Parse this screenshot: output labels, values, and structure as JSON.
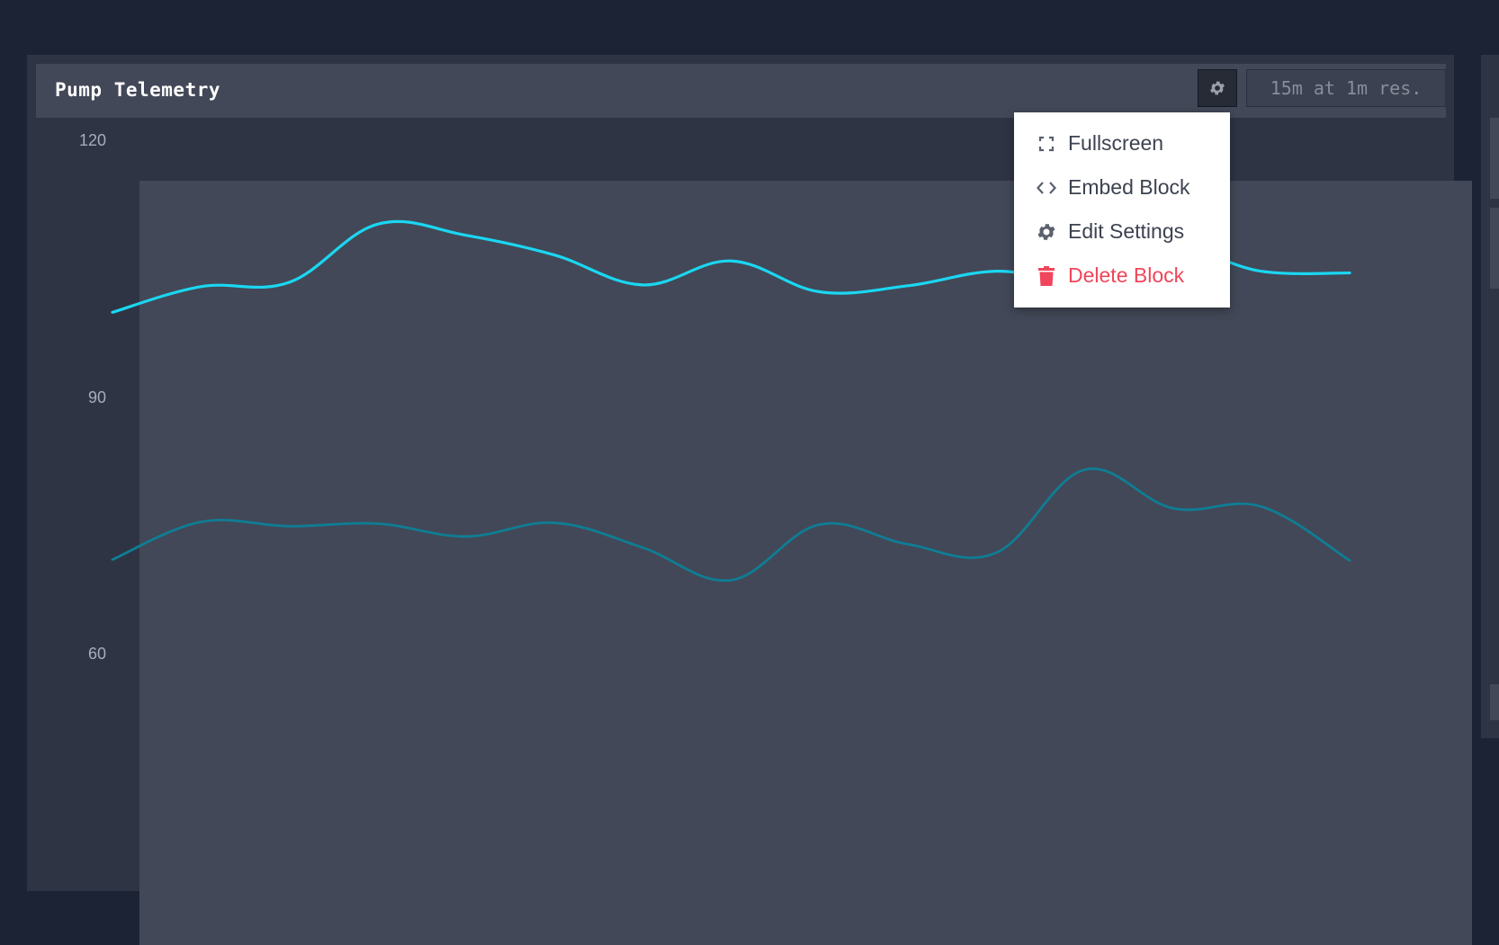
{
  "block": {
    "title": "Pump Telemetry",
    "range_label": "15m at 1m res."
  },
  "menu": {
    "items": [
      {
        "label": "Fullscreen",
        "icon": "fullscreen-icon"
      },
      {
        "label": "Embed Block",
        "icon": "code-icon"
      },
      {
        "label": "Edit Settings",
        "icon": "gear-icon"
      },
      {
        "label": "Delete Block",
        "icon": "trash-icon",
        "color": "#f0455a"
      }
    ]
  },
  "chart_data": {
    "type": "line",
    "title": "",
    "xlabel": "",
    "ylabel": "",
    "ylim": [
      30,
      121
    ],
    "y_ticks": [
      "120",
      "90",
      "60"
    ],
    "y_tick_values": [
      120,
      90,
      60
    ],
    "x": [
      0,
      1,
      2,
      3,
      4,
      5,
      6,
      7,
      8,
      9,
      10,
      11,
      12,
      13,
      14
    ],
    "series": [
      {
        "color": "#1ad7f2",
        "values": [
          100.0,
          103.0,
          103.5,
          110.3,
          109.0,
          106.7,
          103.2,
          106.0,
          102.4,
          103.1,
          104.8,
          103.7,
          107.5,
          104.8,
          104.6
        ]
      },
      {
        "color": "#0f7d94",
        "values": [
          71.1,
          75.5,
          75.0,
          75.3,
          73.8,
          75.4,
          72.5,
          68.7,
          75.2,
          72.9,
          71.9,
          81.6,
          77.1,
          77.3,
          71.0
        ]
      }
    ],
    "grid": false,
    "legend": "none"
  }
}
